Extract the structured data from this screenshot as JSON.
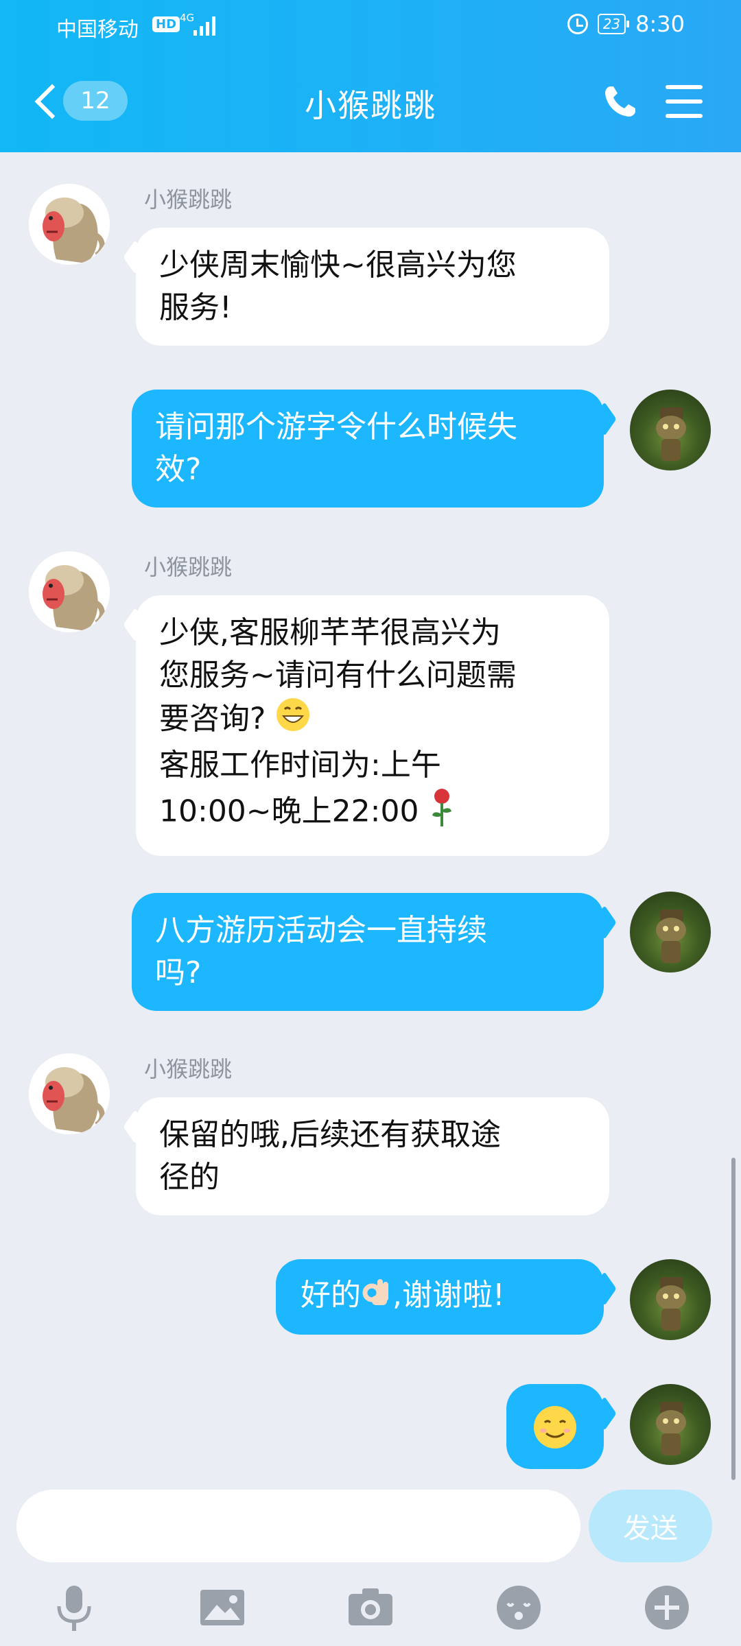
{
  "status_bar": {
    "carrier": "中国移动",
    "hd": "HD",
    "network": "4G",
    "battery": "23",
    "time": "8:30"
  },
  "header": {
    "back_badge": "12",
    "title": "小猴跳跳"
  },
  "messages": [
    {
      "side": "in",
      "sender": "小猴跳跳",
      "lines": [
        "少侠周末愉快~很高兴为您",
        "服务!"
      ]
    },
    {
      "side": "out",
      "lines": [
        "请问那个游字令什么时候失",
        "效?"
      ]
    },
    {
      "side": "in",
      "sender": "小猴跳跳",
      "lines": [
        "少侠,客服柳芊芊很高兴为",
        "您服务~请问有什么问题需",
        "要咨询?",
        "客服工作时间为:上午",
        "10:00~晚上22:00"
      ]
    },
    {
      "side": "out",
      "lines": [
        "八方游历活动会一直持续",
        "吗?"
      ]
    },
    {
      "side": "in",
      "sender": "小猴跳跳",
      "lines": [
        "保留的哦,后续还有获取途",
        "径的"
      ]
    },
    {
      "side": "out",
      "lines": [
        "好的",
        ",谢谢啦!"
      ]
    },
    {
      "side": "out",
      "emoji": "smile"
    }
  ],
  "input": {
    "value": "",
    "send_label": "发送"
  },
  "toolbar": [
    "microphone-icon",
    "image-icon",
    "camera-icon",
    "emoji-icon",
    "plus-icon"
  ],
  "colors": {
    "header": "#12b7f5",
    "outgoing_bubble": "#1cb7ff",
    "incoming_bubble": "#ffffff",
    "background": "#eaedf4",
    "send_button": "#b8e8fb"
  }
}
